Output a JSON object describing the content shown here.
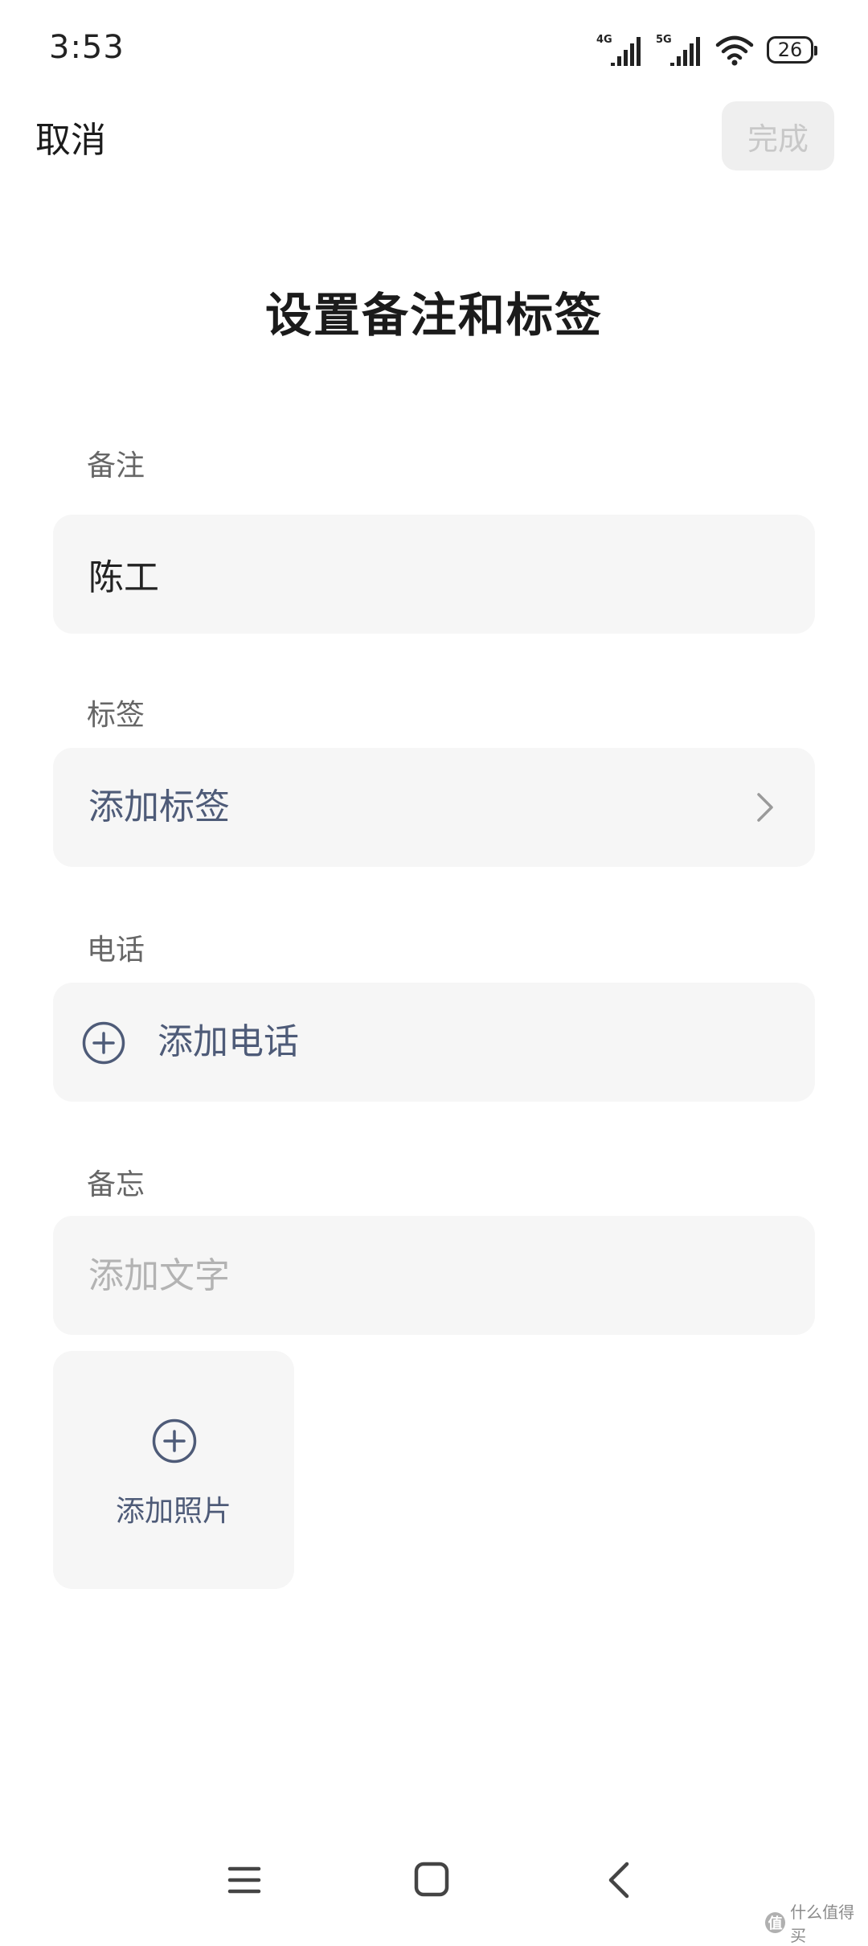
{
  "status_bar": {
    "time": "3:53",
    "network_1": "4G",
    "network_2": "5G",
    "battery": "26",
    "icons": [
      "signal-icon",
      "signal-icon",
      "wifi-icon",
      "battery-icon"
    ]
  },
  "header": {
    "cancel": "取消",
    "done": "完成"
  },
  "title": "设置备注和标签",
  "sections": {
    "remark": {
      "label": "备注",
      "value": "陈工",
      "placeholder": ""
    },
    "tags": {
      "label": "标签",
      "action": "添加标签"
    },
    "phone": {
      "label": "电话",
      "action": "添加电话"
    },
    "memo": {
      "label": "备忘",
      "placeholder": "添加文字",
      "photo_action": "添加照片"
    }
  },
  "watermark": {
    "badge": "值",
    "text": "什么值得买"
  },
  "colors": {
    "accent_text": "#4e5b78",
    "field_bg": "#f6f6f6",
    "placeholder": "#b3b3b3",
    "done_disabled_bg": "#efefef",
    "done_disabled_text": "#c8c8c8"
  }
}
